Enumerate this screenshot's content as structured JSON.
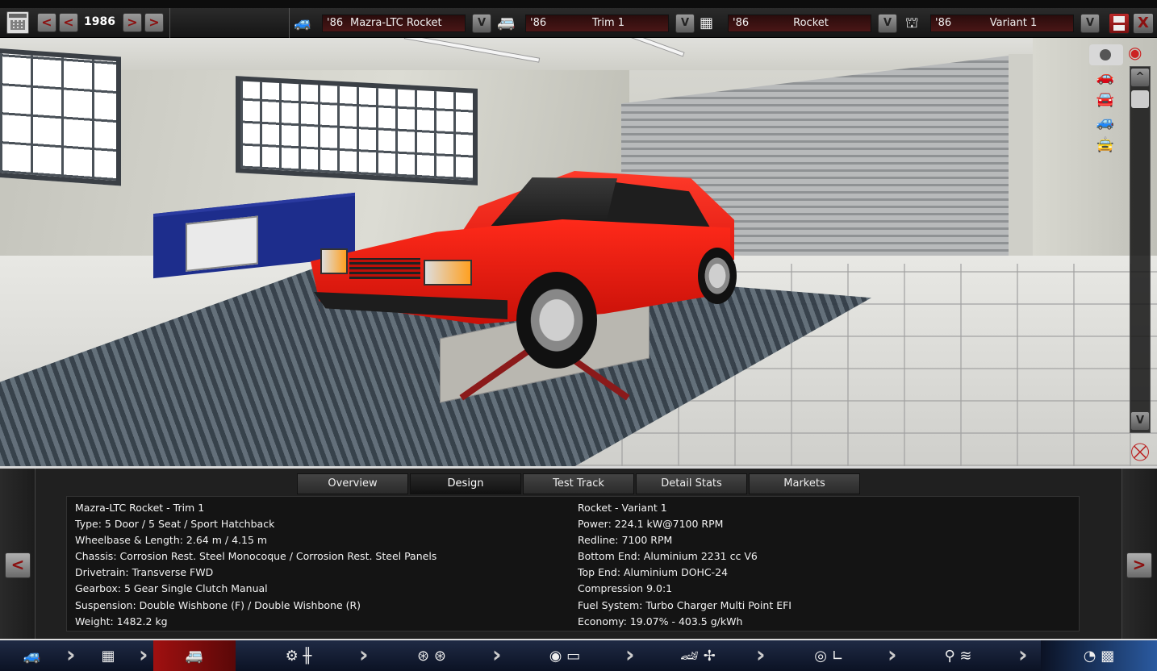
{
  "toolbar": {
    "year": "1986",
    "prev_label": "<",
    "next_label": ">",
    "model": {
      "year": "'86",
      "name": "Mazra-LTC Rocket"
    },
    "trim": {
      "year": "'86",
      "name": "Trim 1"
    },
    "engine": {
      "year": "'86",
      "name": "Rocket"
    },
    "variant": {
      "year": "'86",
      "name": "Variant 1"
    },
    "dropdown_label": "V",
    "close_label": "X"
  },
  "viewer": {
    "scroll_up_label": "^",
    "scroll_down_label": "V"
  },
  "tabs": [
    "Overview",
    "Design",
    "Test Track",
    "Detail Stats",
    "Markets"
  ],
  "active_tab": "Design",
  "overview": {
    "left": [
      "Mazra-LTC Rocket - Trim 1",
      "Type: 5 Door / 5 Seat / Sport Hatchback",
      "Wheelbase & Length: 2.64 m / 4.15 m",
      "Chassis: Corrosion Rest. Steel Monocoque / Corrosion Rest. Steel Panels",
      "Drivetrain: Transverse FWD",
      "Gearbox: 5 Gear Single Clutch Manual",
      "Suspension: Double Wishbone (F) / Double Wishbone (R)",
      "Weight: 1482.2 kg"
    ],
    "right": [
      "Rocket - Variant 1",
      "Power: 224.1 kW@7100 RPM",
      "Redline: 7100 RPM",
      "Bottom End: Aluminium 2231 cc V6",
      "Top End: Aluminium DOHC-24",
      "Compression 9.0:1",
      "Fuel System: Turbo Charger Multi Point EFI",
      "Economy: 19.07% - 403.5 g/kWh"
    ],
    "prev_label": "<",
    "next_label": ">"
  },
  "bottom_nav": [
    {
      "icon": "car-model-icon"
    },
    {
      "icon": "chassis-icon"
    },
    {
      "icon": "trim-icon"
    },
    {
      "icon": "gearbox-icon"
    },
    {
      "icon": "wheels-icon"
    },
    {
      "icon": "body-icon"
    },
    {
      "icon": "interior-icon"
    },
    {
      "icon": "suspension-icon"
    },
    {
      "icon": "test-icon"
    }
  ],
  "colors": {
    "accent": "#8b1010",
    "car": "#ff2a1a",
    "nav_active": "#a01010"
  }
}
